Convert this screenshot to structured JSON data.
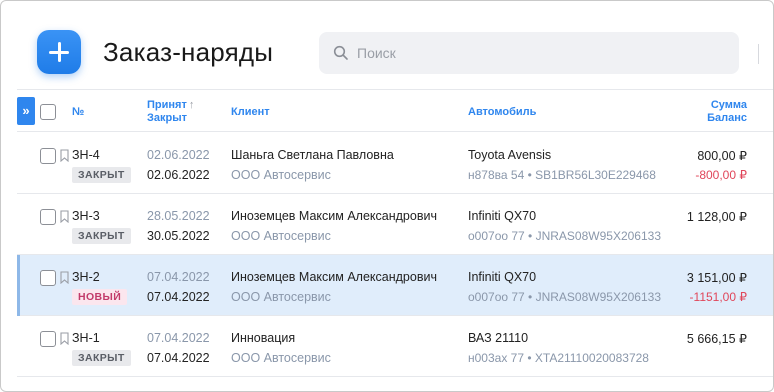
{
  "header": {
    "title": "Заказ-наряды",
    "add_icon": "plus-icon"
  },
  "search": {
    "placeholder": "Поиск",
    "icon": "search-icon"
  },
  "table": {
    "expand_icon": "»",
    "columns": {
      "number": "№",
      "accepted_line1": "Принят",
      "accepted_arrow": "↑",
      "accepted_line2": "Закрыт",
      "client": "Клиент",
      "car": "Автомобиль",
      "sum_line1": "Сумма",
      "sum_line2": "Баланс"
    },
    "rows": [
      {
        "number": "ЗН-4",
        "status": "ЗАКРЫТ",
        "accepted": "02.06.2022",
        "closed": "02.06.2022",
        "client": "Шаньга Светлана Павловна",
        "org": "ООО Автосервис",
        "car": "Toyota Avensis",
        "plate": "н878ва 54 • SB1BR56L30E229468",
        "sum": "800,00 ₽",
        "balance": "-800,00 ₽"
      },
      {
        "number": "ЗН-3",
        "status": "ЗАКРЫТ",
        "accepted": "28.05.2022",
        "closed": "30.05.2022",
        "client": "Иноземцев Максим Александрович",
        "org": "ООО Автосервис",
        "car": "Infiniti QX70",
        "plate": "о007оо 77 • JNRAS08W95X206133",
        "sum": "1 128,00 ₽",
        "balance": ""
      },
      {
        "number": "ЗН-2",
        "status": "НОВЫЙ",
        "accepted": "07.04.2022",
        "closed": "07.04.2022",
        "client": "Иноземцев Максим Александрович",
        "org": "ООО Автосервис",
        "car": "Infiniti QX70",
        "plate": "о007оо 77 • JNRAS08W95X206133",
        "sum": "3 151,00 ₽",
        "balance": "-1151,00 ₽"
      },
      {
        "number": "ЗН-1",
        "status": "ЗАКРЫТ",
        "accepted": "07.04.2022",
        "closed": "07.04.2022",
        "client": "Инновация",
        "org": "ООО Автосервис",
        "car": "ВАЗ 21110",
        "plate": "н003ах 77 • XTA21110020083728",
        "sum": "5 666,15 ₽",
        "balance": ""
      }
    ]
  },
  "colors": {
    "accent": "#2f86ee",
    "negative": "#e0465a",
    "selected_row": "#e0edfb"
  }
}
